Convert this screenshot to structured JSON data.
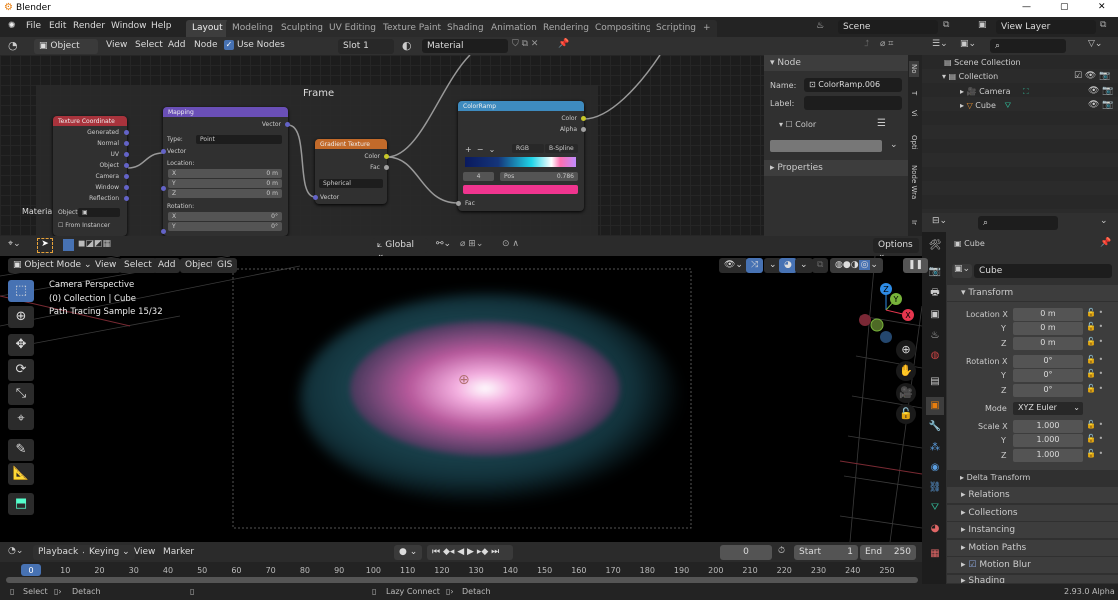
{
  "window": {
    "title": "Blender",
    "controls": [
      "—",
      "▢",
      "✕"
    ]
  },
  "menu": [
    "File",
    "Edit",
    "Render",
    "Window",
    "Help"
  ],
  "workspaces": [
    "Layout",
    "Modeling",
    "Sculpting",
    "UV Editing",
    "Texture Paint",
    "Shading",
    "Animation",
    "Rendering",
    "Compositing",
    "Scripting",
    "+"
  ],
  "active_workspace": "Layout",
  "scene": {
    "name": "Scene",
    "view_layer": "View Layer"
  },
  "node_header": {
    "mode": "Object",
    "view": "View",
    "select": "Select",
    "add": "Add",
    "node": "Node",
    "use_nodes": "Use Nodes",
    "use_nodes_checked": true,
    "slot": "Slot 1",
    "material": "Material"
  },
  "node_editor": {
    "frame_label": "Frame",
    "material_label": "Material",
    "tex_coord": {
      "title": "Texture Coordinate",
      "outputs": [
        "Generated",
        "Normal",
        "UV",
        "Object",
        "Camera",
        "Window",
        "Reflection"
      ],
      "object_label": "Object:",
      "from_instancer": "From Instancer"
    },
    "mapping": {
      "title": "Mapping",
      "output": "Vector",
      "type_label": "Type:",
      "type_value": "Point",
      "input": "Vector",
      "location_label": "Location:",
      "location": [
        [
          "X",
          "0 m"
        ],
        [
          "Y",
          "0 m"
        ],
        [
          "Z",
          "0 m"
        ]
      ],
      "rotation_label": "Rotation:",
      "rotation": [
        [
          "X",
          "0°"
        ],
        [
          "Y",
          "0°"
        ]
      ]
    },
    "gradient": {
      "title": "Gradient Texture",
      "outputs": [
        "Color",
        "Fac"
      ],
      "type": "Spherical",
      "input": "Vector"
    },
    "colorramp": {
      "title": "ColorRamp",
      "outputs": [
        "Color",
        "Alpha"
      ],
      "color_mode": "RGB",
      "interpolation": "B-Spline",
      "index": "4",
      "pos_label": "Pos",
      "pos_value": "0.786",
      "active_color": "#f0358f",
      "input": "Fac",
      "gradient_stops": [
        "#0a1a5e",
        "#15357a",
        "#1fd5e8",
        "#ffffff",
        "#ff6fb0",
        "#c08cff"
      ]
    }
  },
  "node_sidebar": {
    "section": "Node",
    "name_label": "Name:",
    "name_value": "ColorRamp.006",
    "label_label": "Label:",
    "label_value": "",
    "color_label": "Color",
    "properties": "Properties",
    "tabs": [
      "No",
      "T",
      "Vi",
      "Opti",
      "Node Wra",
      "Ir"
    ]
  },
  "outliner": {
    "items": [
      {
        "name": "Scene Collection",
        "level": 0
      },
      {
        "name": "Collection",
        "level": 1
      },
      {
        "name": "Camera",
        "level": 2
      },
      {
        "name": "Cube",
        "level": 2
      }
    ]
  },
  "properties": {
    "object_name": "Cube",
    "data_name": "Cube",
    "transform": "Transform",
    "location_label": "Location X",
    "location": [
      "0 m",
      "0 m",
      "0 m"
    ],
    "rotation_label": "Rotation X",
    "rotation": [
      "0°",
      "0°",
      "0°"
    ],
    "mode_label": "Mode",
    "mode": "XYZ Euler",
    "scale_label": "Scale X",
    "scale": [
      "1.000",
      "1.000",
      "1.000"
    ],
    "axis_y": "Y",
    "axis_z": "Z",
    "delta": "Delta Transform",
    "sections": [
      "Relations",
      "Collections",
      "Instancing",
      "Motion Paths",
      "Motion Blur",
      "Shading"
    ]
  },
  "viewport": {
    "orientation": "Global",
    "options": "Options",
    "mode": "Object Mode",
    "menus": [
      "View",
      "Select",
      "Add",
      "Object",
      "GIS"
    ],
    "overlay": [
      "Camera Perspective",
      "(0) Collection | Cube",
      "Path Tracing Sample 15/32"
    ],
    "gizmo": {
      "x": "X",
      "y": "Y",
      "z": "Z"
    }
  },
  "timeline": {
    "menus": [
      "Playback",
      "Keying",
      "View",
      "Marker"
    ],
    "current_frame": "0",
    "start_label": "Start",
    "start": "1",
    "end_label": "End",
    "end": "250",
    "ticks": [
      0,
      10,
      20,
      30,
      40,
      50,
      60,
      70,
      80,
      90,
      100,
      110,
      120,
      130,
      140,
      150,
      160,
      170,
      180,
      190,
      200,
      210,
      220,
      230,
      240,
      250
    ]
  },
  "statusbar": {
    "select": "Select",
    "detach": "Detach",
    "lazy_connect": "Lazy Connect",
    "detach2": "Detach",
    "version": "2.93.0 Alpha"
  },
  "colors": {
    "accent": "#4772b3",
    "blender_orange": "#e87d0d",
    "tex_coord_header": "#a8333c",
    "mapping_header": "#6a4fb7",
    "gradient_header": "#c26a2a",
    "colorramp_header": "#3e8bbf"
  }
}
